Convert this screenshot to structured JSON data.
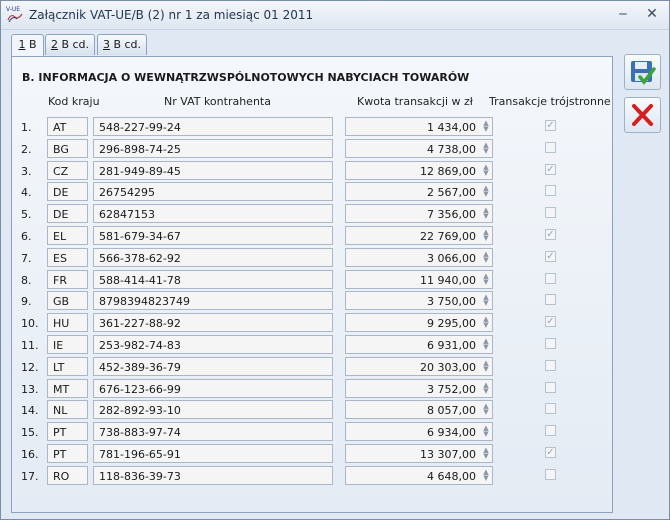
{
  "window": {
    "app_logo_text": "V-UE",
    "title": "Załącznik VAT-UE/B (2) nr 1 za miesiąc 01 2011",
    "minimize": "‒",
    "close": "✕"
  },
  "tabs": [
    {
      "hotkey": "1",
      "rest": " B"
    },
    {
      "hotkey": "2",
      "rest": " B cd."
    },
    {
      "hotkey": "3",
      "rest": " B cd."
    }
  ],
  "section": {
    "title": "B. INFORMACJA O WEWNĄTRZWSPÓLNOTOWYCH NABYCIACH TOWARÓW",
    "headers": {
      "country": "Kod kraju",
      "vat": "Nr VAT kontrahenta",
      "amount": "Kwota transakcji w zł",
      "triangular": "Transakcje trójstronne"
    },
    "rows": [
      {
        "num": "1.",
        "country": "AT",
        "vat": "548-227-99-24",
        "amount": "1 434,00",
        "triangular": true
      },
      {
        "num": "2.",
        "country": "BG",
        "vat": "296-898-74-25",
        "amount": "4 738,00",
        "triangular": false
      },
      {
        "num": "3.",
        "country": "CZ",
        "vat": "281-949-89-45",
        "amount": "12 869,00",
        "triangular": true
      },
      {
        "num": "4.",
        "country": "DE",
        "vat": "26754295",
        "amount": "2 567,00",
        "triangular": false
      },
      {
        "num": "5.",
        "country": "DE",
        "vat": "62847153",
        "amount": "7 356,00",
        "triangular": false
      },
      {
        "num": "6.",
        "country": "EL",
        "vat": "581-679-34-67",
        "amount": "22 769,00",
        "triangular": true
      },
      {
        "num": "7.",
        "country": "ES",
        "vat": "566-378-62-92",
        "amount": "3 066,00",
        "triangular": true
      },
      {
        "num": "8.",
        "country": "FR",
        "vat": "588-414-41-78",
        "amount": "11 940,00",
        "triangular": false
      },
      {
        "num": "9.",
        "country": "GB",
        "vat": "8798394823749",
        "amount": "3 750,00",
        "triangular": false
      },
      {
        "num": "10.",
        "country": "HU",
        "vat": "361-227-88-92",
        "amount": "9 295,00",
        "triangular": true
      },
      {
        "num": "11.",
        "country": "IE",
        "vat": "253-982-74-83",
        "amount": "6 931,00",
        "triangular": false
      },
      {
        "num": "12.",
        "country": "LT",
        "vat": "452-389-36-79",
        "amount": "20 303,00",
        "triangular": false
      },
      {
        "num": "13.",
        "country": "MT",
        "vat": "676-123-66-99",
        "amount": "3 752,00",
        "triangular": false
      },
      {
        "num": "14.",
        "country": "NL",
        "vat": "282-892-93-10",
        "amount": "8 057,00",
        "triangular": false
      },
      {
        "num": "15.",
        "country": "PT",
        "vat": "738-883-97-74",
        "amount": "6 934,00",
        "triangular": false
      },
      {
        "num": "16.",
        "country": "PT",
        "vat": "781-196-65-91",
        "amount": "13 307,00",
        "triangular": true
      },
      {
        "num": "17.",
        "country": "RO",
        "vat": "118-836-39-73",
        "amount": "4 648,00",
        "triangular": false
      }
    ]
  },
  "colors": {
    "save_icon": "#3a6fb8",
    "cancel_icon": "#d62020",
    "check_green": "#3aa33a"
  },
  "icons": {
    "save": "save-disk-icon",
    "cancel": "cancel-x-icon"
  }
}
